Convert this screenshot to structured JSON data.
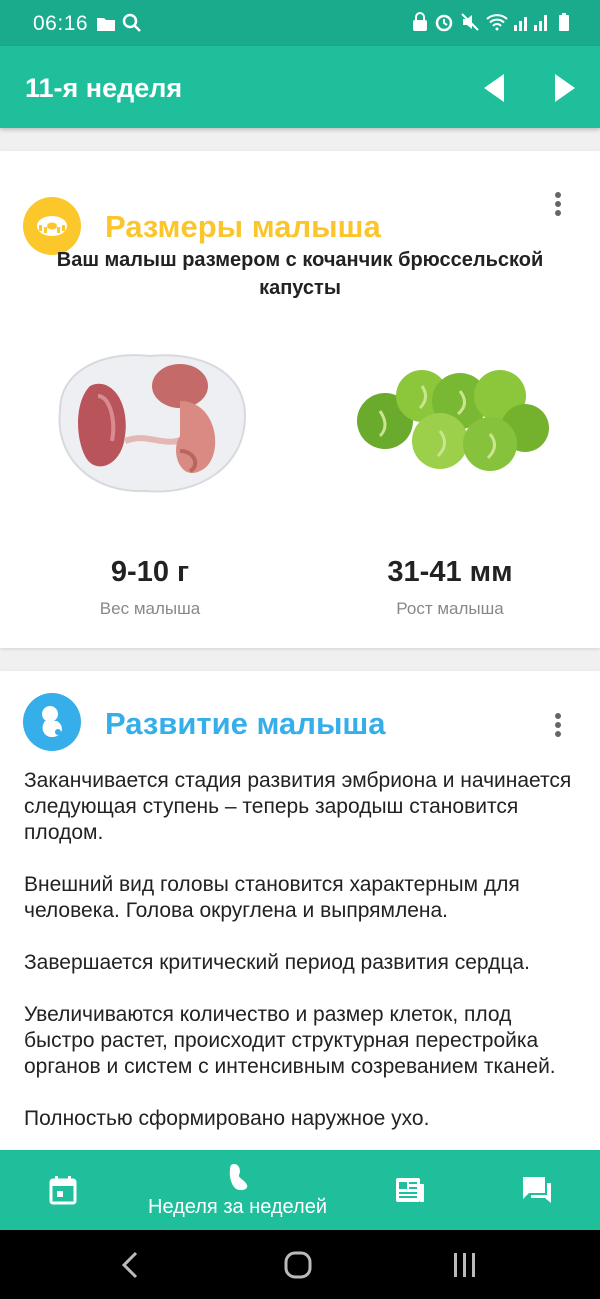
{
  "status_bar": {
    "time": "06:16",
    "icons": [
      "folder-icon",
      "search-icon",
      "lock-icon",
      "alarm-icon",
      "mute-icon",
      "wifi-icon",
      "signal-icon",
      "battery-icon"
    ]
  },
  "app_bar": {
    "title": "11-я неделя",
    "prev_icon": "arrow-left-icon",
    "next_icon": "arrow-right-icon"
  },
  "size_card": {
    "title": "Размеры малыша",
    "icon": "measuring-tape-icon",
    "description": "Ваш малыш размером с кочанчик брюссельской капусты",
    "weight_value": "9-10 г",
    "weight_label": "Вес малыша",
    "height_value": "31-41 мм",
    "height_label": "Рост малыша",
    "accent": "#fbc62c"
  },
  "development_card": {
    "title": "Развитие малыша",
    "icon": "baby-icon",
    "accent": "#36aeea",
    "paragraphs": [
      "Заканчивается стадия развития эмбриона и начинается следующая ступень – теперь зародыш становится плодом.",
      "Внешний вид головы становится характерным для человека. Голова округлена и выпрямлена.",
      "Завершается критический период развития сердца.",
      "Увеличиваются количество и размер клеток, плод быстро растет, происходит структурная перестройка органов и систем с интенсивным созреванием тканей.",
      "Полностью сформировано наружное ухо."
    ]
  },
  "bottom_nav": {
    "week_label": "Неделя за неделей",
    "items": [
      "calendar-icon",
      "baby-foot-icon",
      "articles-icon",
      "chat-icon"
    ]
  },
  "colors": {
    "primary": "#1fbf9c",
    "status_bar": "#1aab8c"
  }
}
